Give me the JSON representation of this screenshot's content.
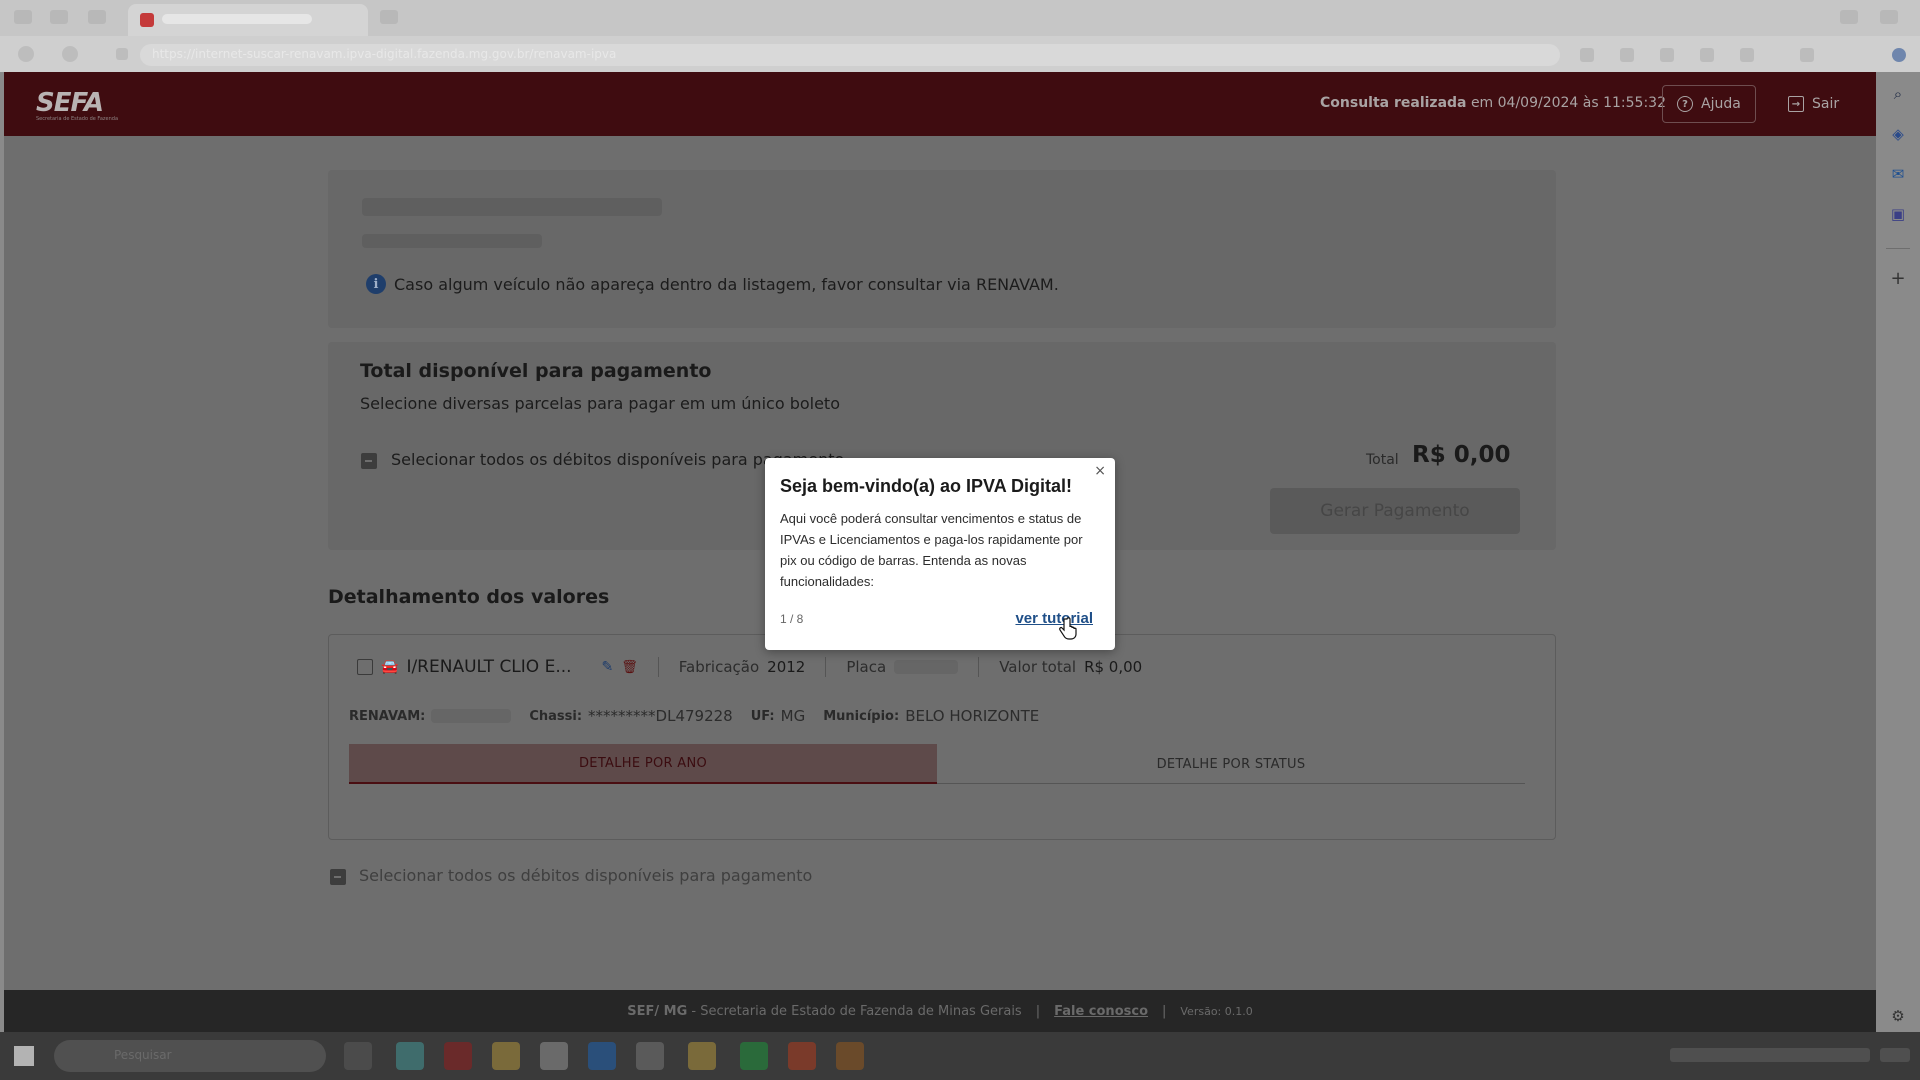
{
  "header": {
    "logo": "SEFA",
    "logo_sub": "Secretaria de Estado de Fazenda",
    "consulta_label": "Consulta realizada",
    "consulta_date": "em 04/09/2024 às 11:55:32",
    "ajuda_label": "Ajuda",
    "sair_label": "Sair"
  },
  "info": {
    "notice": "Caso algum veículo não apareça dentro da listagem, favor consultar via RENAVAM."
  },
  "payment": {
    "title": "Total disponível para pagamento",
    "subtitle": "Selecione diversas parcelas para pagar em um único boleto",
    "select_all_label": "Selecionar todos os débitos disponíveis para pagamento",
    "total_label": "Total",
    "total_value": "R$ 0,00",
    "generate_button": "Gerar Pagamento"
  },
  "details": {
    "title": "Detalhamento dos valores",
    "vehicle": {
      "name": "I/RENAULT CLIO E...",
      "fabricacao_label": "Fabricação",
      "fabricacao_value": "2012",
      "placa_label": "Placa",
      "valor_total_label": "Valor total",
      "valor_total_value": "R$ 0,00",
      "renavam_label": "RENAVAM:",
      "chassi_label": "Chassi:",
      "chassi_value": "*********DL479228",
      "uf_label": "UF:",
      "uf_value": "MG",
      "municipio_label": "Município:",
      "municipio_value": "BELO HORIZONTE"
    },
    "tabs": [
      {
        "label": "DETALHE POR ANO",
        "active": true
      },
      {
        "label": "DETALHE POR STATUS",
        "active": false
      }
    ],
    "select_all_bottom": "Selecionar todos os débitos disponíveis para pagamento"
  },
  "footer": {
    "org": "SEF/ MG",
    "org_desc": "- Secretaria de Estado de Fazenda de Minas Gerais",
    "sep": "|",
    "contact": "Fale conosco",
    "version": "Versão: 0.1.0"
  },
  "popover": {
    "title": "Seja bem-vindo(a) ao IPVA Digital!",
    "body": "Aqui você poderá consultar vencimentos e status de IPVAs e Licenciamentos e paga-los rapidamente por pix ou código de barras. Entenda as novas funcionalidades:",
    "step": "1 / 8",
    "link": "ver tutorial",
    "close": "×"
  },
  "browser": {
    "url_text": "https://internet-suscar-renavam.ipva-digital.fazenda.mg.gov.br/renavam-ipva"
  },
  "taskbar": {
    "search_placeholder": "Pesquisar"
  },
  "colors": {
    "header_bg": "#3f0c10",
    "link_blue": "#1f4f88",
    "overlay_gray": "#6e6e6e"
  }
}
